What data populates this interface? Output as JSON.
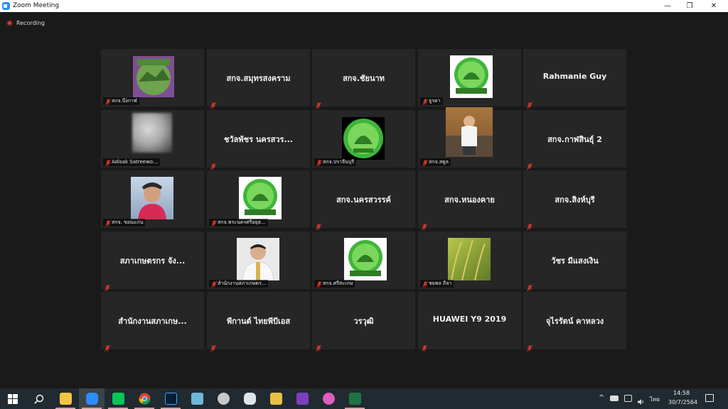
{
  "window": {
    "title": "Zoom Meeting",
    "minimize": "—",
    "restore": "❐",
    "close": "✕"
  },
  "recording": {
    "label": "Recording"
  },
  "tiles": [
    {
      "name": "",
      "label": "สกจ.บึงกาฬ"
    },
    {
      "name": "สกจ.สมุทรสงคราม",
      "label": ""
    },
    {
      "name": "สกจ.ชัยนาท",
      "label": ""
    },
    {
      "name": "",
      "label": "ธูรตา"
    },
    {
      "name": "Rahmanie Guy",
      "label": ""
    },
    {
      "name": "",
      "label": "Adisak Satreewo..."
    },
    {
      "name": "ชวัลพัชร นครสวร...",
      "label": ""
    },
    {
      "name": "",
      "label": "สกจ.ปราจีนบุรี"
    },
    {
      "name": "",
      "label": "สกจ.สตูล"
    },
    {
      "name": "สกจ.กาฬสินธุ์ 2",
      "label": ""
    },
    {
      "name": "",
      "label": "สกจ. ขอนแก่น"
    },
    {
      "name": "",
      "label": "สกจ.พระนครศรีอยุธ..."
    },
    {
      "name": "สกจ.นครสวรรค์",
      "label": ""
    },
    {
      "name": "สกจ.หนองคาย",
      "label": ""
    },
    {
      "name": "สกจ.สิงห์บุรี",
      "label": ""
    },
    {
      "name": "สภาเกษตรกร จัง...",
      "label": ""
    },
    {
      "name": "",
      "label": "สำนักงานสภาเกษตร..."
    },
    {
      "name": "",
      "label": "สกจ.ศรีสะเกษ"
    },
    {
      "name": "",
      "label": "ชยพล ถีลา"
    },
    {
      "name": "วัชร มีแสงเงิน",
      "label": ""
    },
    {
      "name": "สำนักงานสภาเกษ...",
      "label": ""
    },
    {
      "name": "พีกานต์ ไทยพีบีเอส",
      "label": ""
    },
    {
      "name": "วรวุฒิ",
      "label": ""
    },
    {
      "name": "HUAWEI Y9 2019",
      "label": ""
    },
    {
      "name": "จุไรรัตน์ คาหลวง",
      "label": ""
    }
  ],
  "taskbar": {
    "language": "ไทย",
    "time": "14:58",
    "date": "30/7/2564"
  },
  "colors": {
    "tile_bg": "#262626",
    "meeting_bg": "#1a1a1a",
    "mute_red": "#e0392b",
    "zoom_blue": "#2d8cff"
  }
}
